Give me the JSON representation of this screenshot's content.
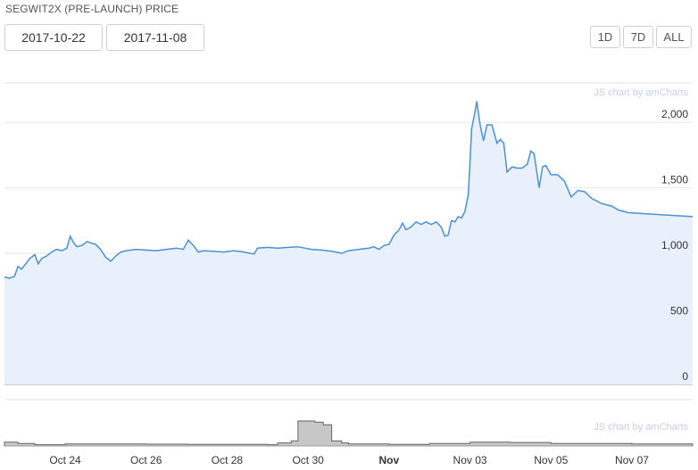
{
  "header": {
    "title": "SEGWIT2X (PRE-LAUNCH) PRICE",
    "start_date": "2017-10-22",
    "end_date": "2017-11-08",
    "range_buttons": [
      "1D",
      "7D",
      "ALL"
    ],
    "credit": "JS chart by amCharts"
  },
  "colors": {
    "line": "#4a90d9",
    "fill": "#e8f0fb",
    "volume_fill": "#c7c7c7",
    "volume_stroke": "#666666",
    "grid": "#e6e6e6"
  },
  "chart_data": {
    "type": "area",
    "ylim": [
      0,
      2300
    ],
    "yticks": [
      0,
      500,
      1000,
      1500,
      2000
    ],
    "ytick_labels": [
      "0",
      "500",
      "1,000",
      "1,500",
      "2,000"
    ],
    "xlim": [
      "2017-10-22 12:00",
      "2017-11-08 12:00"
    ],
    "xticks": [
      {
        "date": "2017-10-24",
        "label": "Oct 24",
        "bold": false
      },
      {
        "date": "2017-10-26",
        "label": "Oct 26",
        "bold": false
      },
      {
        "date": "2017-10-28",
        "label": "Oct 28",
        "bold": false
      },
      {
        "date": "2017-10-30",
        "label": "Oct 30",
        "bold": false
      },
      {
        "date": "2017-11-01",
        "label": "Nov",
        "bold": true
      },
      {
        "date": "2017-11-03",
        "label": "Nov 03",
        "bold": false
      },
      {
        "date": "2017-11-05",
        "label": "Nov 05",
        "bold": false
      },
      {
        "date": "2017-11-07",
        "label": "Nov 07",
        "bold": false
      }
    ],
    "price": [
      [
        "2017-10-22 12:00",
        820
      ],
      [
        "2017-10-22 15:00",
        810
      ],
      [
        "2017-10-22 18:00",
        825
      ],
      [
        "2017-10-22 20:00",
        900
      ],
      [
        "2017-10-22 22:00",
        880
      ],
      [
        "2017-10-23 00:00",
        910
      ],
      [
        "2017-10-23 03:00",
        960
      ],
      [
        "2017-10-23 06:00",
        990
      ],
      [
        "2017-10-23 08:00",
        920
      ],
      [
        "2017-10-23 10:00",
        960
      ],
      [
        "2017-10-23 13:00",
        980
      ],
      [
        "2017-10-23 16:00",
        1010
      ],
      [
        "2017-10-23 19:00",
        1030
      ],
      [
        "2017-10-23 22:00",
        1020
      ],
      [
        "2017-10-24 01:00",
        1040
      ],
      [
        "2017-10-24 03:00",
        1130
      ],
      [
        "2017-10-24 05:00",
        1080
      ],
      [
        "2017-10-24 07:00",
        1050
      ],
      [
        "2017-10-24 10:00",
        1060
      ],
      [
        "2017-10-24 13:00",
        1090
      ],
      [
        "2017-10-24 15:00",
        1080
      ],
      [
        "2017-10-24 18:00",
        1070
      ],
      [
        "2017-10-24 21:00",
        1030
      ],
      [
        "2017-10-25 00:00",
        970
      ],
      [
        "2017-10-25 03:00",
        940
      ],
      [
        "2017-10-25 06:00",
        980
      ],
      [
        "2017-10-25 09:00",
        1010
      ],
      [
        "2017-10-25 12:00",
        1020
      ],
      [
        "2017-10-25 18:00",
        1030
      ],
      [
        "2017-10-26 00:00",
        1025
      ],
      [
        "2017-10-26 06:00",
        1020
      ],
      [
        "2017-10-26 12:00",
        1030
      ],
      [
        "2017-10-26 18:00",
        1040
      ],
      [
        "2017-10-26 22:00",
        1030
      ],
      [
        "2017-10-27 01:00",
        1100
      ],
      [
        "2017-10-27 04:00",
        1060
      ],
      [
        "2017-10-27 07:00",
        1010
      ],
      [
        "2017-10-27 10:00",
        1020
      ],
      [
        "2017-10-27 16:00",
        1015
      ],
      [
        "2017-10-27 22:00",
        1010
      ],
      [
        "2017-10-28 04:00",
        1020
      ],
      [
        "2017-10-28 10:00",
        1010
      ],
      [
        "2017-10-28 16:00",
        995
      ],
      [
        "2017-10-28 18:00",
        1040
      ],
      [
        "2017-10-29 00:00",
        1045
      ],
      [
        "2017-10-29 06:00",
        1040
      ],
      [
        "2017-10-29 12:00",
        1045
      ],
      [
        "2017-10-29 18:00",
        1050
      ],
      [
        "2017-10-29 22:00",
        1040
      ],
      [
        "2017-10-30 02:00",
        1030
      ],
      [
        "2017-10-30 08:00",
        1025
      ],
      [
        "2017-10-30 14:00",
        1015
      ],
      [
        "2017-10-30 20:00",
        1000
      ],
      [
        "2017-10-31 00:00",
        1020
      ],
      [
        "2017-10-31 06:00",
        1030
      ],
      [
        "2017-10-31 12:00",
        1040
      ],
      [
        "2017-10-31 15:00",
        1050
      ],
      [
        "2017-10-31 18:00",
        1030
      ],
      [
        "2017-10-31 21:00",
        1060
      ],
      [
        "2017-11-01 00:00",
        1070
      ],
      [
        "2017-11-01 03:00",
        1140
      ],
      [
        "2017-11-01 06:00",
        1180
      ],
      [
        "2017-11-01 08:00",
        1230
      ],
      [
        "2017-11-01 10:00",
        1180
      ],
      [
        "2017-11-01 13:00",
        1200
      ],
      [
        "2017-11-01 16:00",
        1240
      ],
      [
        "2017-11-01 19:00",
        1220
      ],
      [
        "2017-11-01 22:00",
        1240
      ],
      [
        "2017-11-02 01:00",
        1220
      ],
      [
        "2017-11-02 04:00",
        1240
      ],
      [
        "2017-11-02 07:00",
        1200
      ],
      [
        "2017-11-02 09:00",
        1130
      ],
      [
        "2017-11-02 11:00",
        1140
      ],
      [
        "2017-11-02 13:00",
        1250
      ],
      [
        "2017-11-02 15:00",
        1240
      ],
      [
        "2017-11-02 17:00",
        1280
      ],
      [
        "2017-11-02 19:00",
        1270
      ],
      [
        "2017-11-02 21:00",
        1320
      ],
      [
        "2017-11-02 23:00",
        1450
      ],
      [
        "2017-11-03 01:00",
        1950
      ],
      [
        "2017-11-03 03:00",
        2080
      ],
      [
        "2017-11-03 04:00",
        2160
      ],
      [
        "2017-11-03 06:00",
        1980
      ],
      [
        "2017-11-03 08:00",
        1860
      ],
      [
        "2017-11-03 10:00",
        1980
      ],
      [
        "2017-11-03 13:00",
        1980
      ],
      [
        "2017-11-03 16:00",
        1840
      ],
      [
        "2017-11-03 18:00",
        1870
      ],
      [
        "2017-11-03 20:00",
        1840
      ],
      [
        "2017-11-03 22:00",
        1620
      ],
      [
        "2017-11-04 01:00",
        1660
      ],
      [
        "2017-11-04 04:00",
        1650
      ],
      [
        "2017-11-04 07:00",
        1650
      ],
      [
        "2017-11-04 10:00",
        1680
      ],
      [
        "2017-11-04 12:00",
        1780
      ],
      [
        "2017-11-04 14:00",
        1760
      ],
      [
        "2017-11-04 17:00",
        1500
      ],
      [
        "2017-11-04 19:00",
        1660
      ],
      [
        "2017-11-04 21:00",
        1670
      ],
      [
        "2017-11-05 00:00",
        1600
      ],
      [
        "2017-11-05 04:00",
        1600
      ],
      [
        "2017-11-05 08:00",
        1550
      ],
      [
        "2017-11-05 12:00",
        1430
      ],
      [
        "2017-11-05 16:00",
        1480
      ],
      [
        "2017-11-05 20:00",
        1470
      ],
      [
        "2017-11-06 00:00",
        1420
      ],
      [
        "2017-11-06 06:00",
        1380
      ],
      [
        "2017-11-06 12:00",
        1360
      ],
      [
        "2017-11-06 16:00",
        1330
      ],
      [
        "2017-11-06 22:00",
        1310
      ],
      [
        "2017-11-08 12:00",
        1280
      ]
    ],
    "volume": [
      [
        "2017-10-22 12:00",
        0.15
      ],
      [
        "2017-10-22 20:00",
        0.1
      ],
      [
        "2017-10-23 06:00",
        0.05
      ],
      [
        "2017-10-24 00:00",
        0.08
      ],
      [
        "2017-10-26 00:00",
        0.07
      ],
      [
        "2017-10-27 00:00",
        0.06
      ],
      [
        "2017-10-28 00:00",
        0.06
      ],
      [
        "2017-10-29 00:00",
        0.05
      ],
      [
        "2017-10-29 06:00",
        0.12
      ],
      [
        "2017-10-29 14:00",
        0.2
      ],
      [
        "2017-10-29 18:00",
        1.0
      ],
      [
        "2017-10-30 04:00",
        0.95
      ],
      [
        "2017-10-30 09:00",
        0.85
      ],
      [
        "2017-10-30 14:00",
        0.2
      ],
      [
        "2017-10-30 20:00",
        0.12
      ],
      [
        "2017-10-31 00:00",
        0.08
      ],
      [
        "2017-11-01 00:00",
        0.06
      ],
      [
        "2017-11-02 00:00",
        0.1
      ],
      [
        "2017-11-03 00:00",
        0.15
      ],
      [
        "2017-11-04 00:00",
        0.14
      ],
      [
        "2017-11-05 00:00",
        0.1
      ],
      [
        "2017-11-07 00:00",
        0.08
      ],
      [
        "2017-11-08 12:00",
        0.08
      ]
    ]
  }
}
